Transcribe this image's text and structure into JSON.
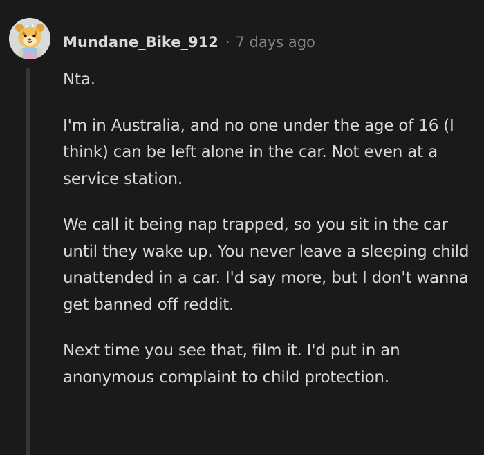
{
  "comment": {
    "username": "Mundane_Bike_912",
    "separator": "·",
    "timestamp": "7 days ago",
    "avatar_icon": "snoo-avatar-icon",
    "paragraphs": [
      "Nta.",
      "I'm in Australia, and no one under the age of 16 (I think) can be left alone in the car. Not even at a service station.",
      "We call it being nap trapped, so you sit in the car until they wake up. You never leave a sleeping child unattended in a car. I'd say more, but I don't wanna get banned off reddit.",
      "Next time you see that, film it. I'd put in an anonymous complaint to child protection."
    ]
  },
  "colors": {
    "background": "#1a1a1b",
    "text": "#d7dadc",
    "muted": "#818384",
    "thread_line": "#343536"
  }
}
